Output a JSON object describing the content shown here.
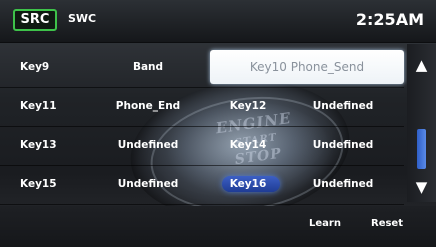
{
  "header": {
    "src_label": "SRC",
    "title": "SWC",
    "clock": "2:25AM"
  },
  "rows": [
    {
      "key_left": "Key9",
      "value_left": "Band",
      "key_right": "Key10 Phone_Send",
      "value_right": ""
    },
    {
      "key_left": "Key11",
      "value_left": "Phone_End",
      "key_right": "Key12",
      "value_right": "Undefined"
    },
    {
      "key_left": "Key13",
      "value_left": "Undefined",
      "key_right": "Key14",
      "value_right": "Undefined"
    },
    {
      "key_left": "Key15",
      "value_left": "Undefined",
      "key_right": "Key16",
      "value_right": "Undefined"
    }
  ],
  "selected_key": "Key10",
  "highlighted_key": "Key16",
  "scrollbar": {
    "up_icon": "arrow-up-icon",
    "down_icon": "arrow-down-icon"
  },
  "background_art": {
    "line1": "ENGINE",
    "line2": "START",
    "line3": "STOP"
  },
  "footer": {
    "learn_label": "Learn",
    "reset_label": "Reset"
  },
  "colors": {
    "src_border": "#3ec24a",
    "selection_bg": "#ffffff",
    "highlight": "#3c5fc4",
    "scroll_thumb": "#3f6fd8"
  }
}
